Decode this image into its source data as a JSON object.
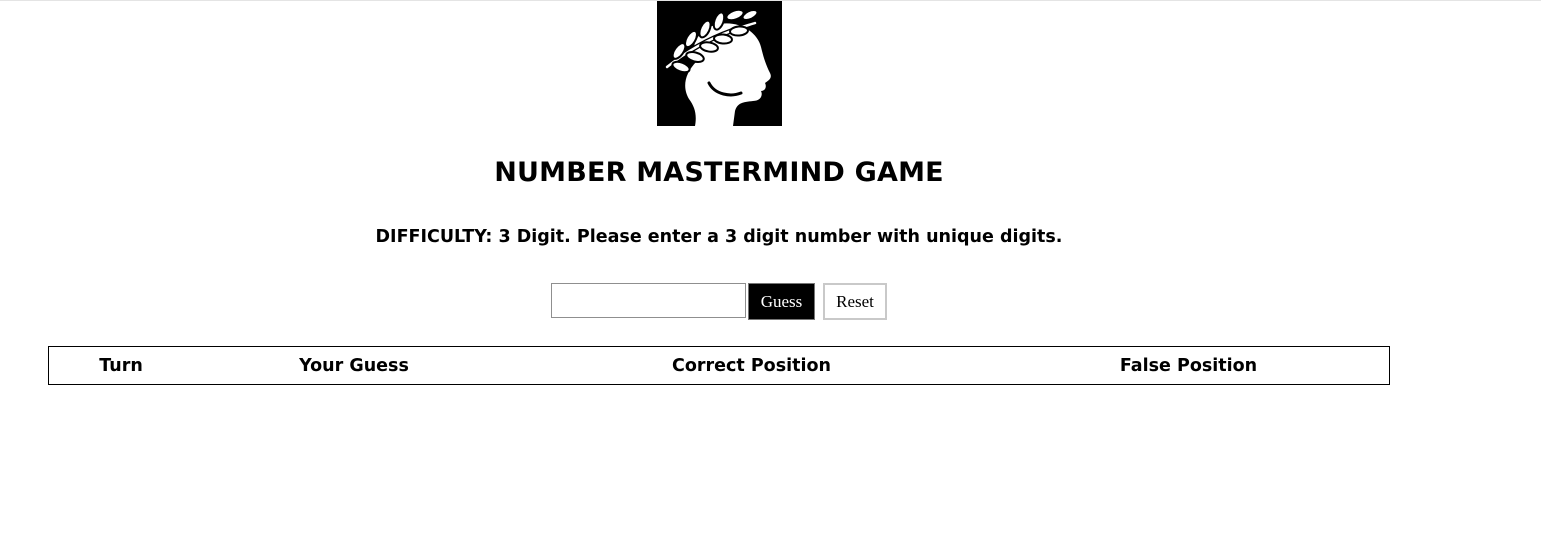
{
  "logo": {
    "icon": "laurel-head-icon"
  },
  "page": {
    "title": "NUMBER MASTERMIND GAME",
    "difficulty_text": "DIFFICULTY: 3 Digit. Please enter a 3 digit number with unique digits."
  },
  "guess_form": {
    "input_value": "",
    "input_placeholder": "",
    "guess_label": "Guess",
    "reset_label": "Reset"
  },
  "results_table": {
    "headers": [
      "Turn",
      "Your Guess",
      "Correct Position",
      "False Position"
    ],
    "rows": []
  },
  "colors": {
    "background": "#ffffff",
    "text": "#000000",
    "guess_button_bg": "#000000",
    "guess_button_text": "#ffffff"
  }
}
